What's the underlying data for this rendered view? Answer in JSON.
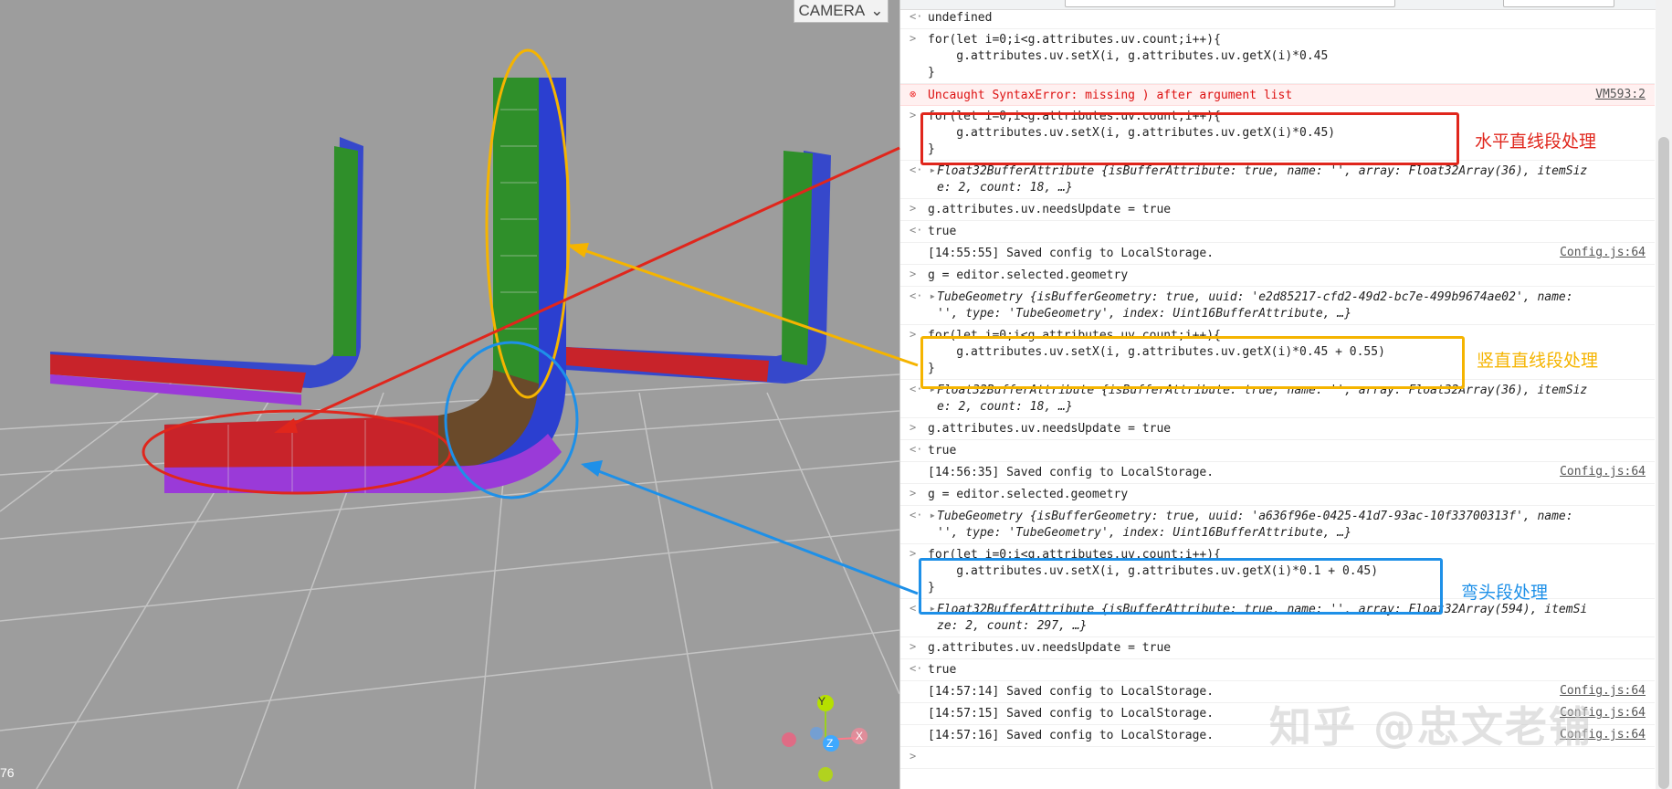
{
  "viewport": {
    "camera_label": "CAMERA",
    "fps_text": "76",
    "gizmo": {
      "y": "Y",
      "z": "Z",
      "x": "X"
    }
  },
  "console": {
    "rows": [
      {
        "prefix": "<·",
        "text": "undefined",
        "source": ""
      },
      {
        "prefix": ">",
        "lines": [
          "for(let i=0;i<g.attributes.uv.count;i++){",
          "    g.attributes.uv.setX(i, g.attributes.uv.getX(i)*0.45",
          "}"
        ],
        "source": ""
      },
      {
        "prefix": "⊗",
        "text": "Uncaught SyntaxError: missing ) after argument list",
        "source": "VM593:2",
        "error": true
      },
      {
        "prefix": ">",
        "lines": [
          "for(let i=0;i<g.attributes.uv.count;i++){",
          "    g.attributes.uv.setX(i, g.attributes.uv.getX(i)*0.45)",
          "}"
        ],
        "source": ""
      },
      {
        "prefix": "<· ▸",
        "lines": [
          "Float32BufferAttribute {isBufferAttribute: true, name: '', array: Float32Array(36), itemSiz",
          "e: 2, count: 18, …}"
        ],
        "source": ""
      },
      {
        "prefix": ">",
        "text": "g.attributes.uv.needsUpdate = true",
        "source": ""
      },
      {
        "prefix": "<·",
        "text": "true",
        "source": ""
      },
      {
        "prefix": "",
        "text": "[14:55:55] Saved config to LocalStorage.",
        "source": "Config.js:64"
      },
      {
        "prefix": ">",
        "text": "g = editor.selected.geometry",
        "source": ""
      },
      {
        "prefix": "<· ▸",
        "lines": [
          "TubeGeometry {isBufferGeometry: true, uuid: 'e2d85217-cfd2-49d2-bc7e-499b9674ae02', name:",
          "'', type: 'TubeGeometry', index: Uint16BufferAttribute, …}"
        ],
        "source": ""
      },
      {
        "prefix": ">",
        "lines": [
          "for(let i=0;i<g.attributes.uv.count;i++){",
          "    g.attributes.uv.setX(i, g.attributes.uv.getX(i)*0.45 + 0.55)",
          "}"
        ],
        "source": ""
      },
      {
        "prefix": "<· ▸",
        "lines": [
          "Float32BufferAttribute {isBufferAttribute: true, name: '', array: Float32Array(36), itemSiz",
          "e: 2, count: 18, …}"
        ],
        "source": ""
      },
      {
        "prefix": ">",
        "text": "g.attributes.uv.needsUpdate = true",
        "source": ""
      },
      {
        "prefix": "<·",
        "text": "true",
        "source": ""
      },
      {
        "prefix": "",
        "text": "[14:56:35] Saved config to LocalStorage.",
        "source": "Config.js:64"
      },
      {
        "prefix": ">",
        "text": "g = editor.selected.geometry",
        "source": ""
      },
      {
        "prefix": "<· ▸",
        "lines": [
          "TubeGeometry {isBufferGeometry: true, uuid: 'a636f96e-0425-41d7-93ac-10f33700313f', name:",
          "'', type: 'TubeGeometry', index: Uint16BufferAttribute, …}"
        ],
        "source": ""
      },
      {
        "prefix": ">",
        "lines": [
          "for(let i=0;i<g.attributes.uv.count;i++){",
          "    g.attributes.uv.setX(i, g.attributes.uv.getX(i)*0.1 + 0.45)",
          "}"
        ],
        "source": ""
      },
      {
        "prefix": "<· ▸",
        "lines": [
          "Float32BufferAttribute {isBufferAttribute: true, name: '', array: Float32Array(594), itemSi",
          "ze: 2, count: 297, …}"
        ],
        "source": ""
      },
      {
        "prefix": ">",
        "text": "g.attributes.uv.needsUpdate = true",
        "source": ""
      },
      {
        "prefix": "<·",
        "text": "true",
        "source": ""
      },
      {
        "prefix": "",
        "text": "[14:57:14] Saved config to LocalStorage.",
        "source": "Config.js:64"
      },
      {
        "prefix": "",
        "text": "[14:57:15] Saved config to LocalStorage.",
        "source": "Config.js:64"
      },
      {
        "prefix": "",
        "text": "[14:57:16] Saved config to LocalStorage.",
        "source": "Config.js:64"
      },
      {
        "prefix": ">",
        "text": "",
        "source": ""
      }
    ]
  },
  "annotations": {
    "horizontal": {
      "label": "水平直线段处理",
      "color": "#e0261c"
    },
    "vertical": {
      "label": "竖直直线段处理",
      "color": "#f5b400"
    },
    "elbow": {
      "label": "弯头段处理",
      "color": "#1e90e8"
    }
  },
  "watermark": "知乎 @忠文老铺",
  "colors": {
    "red_pipe": "#c8232a",
    "green_pipe": "#2f8f2a",
    "blue_pipe": "#2b3fd0",
    "purple_pipe": "#9a3ad8"
  }
}
